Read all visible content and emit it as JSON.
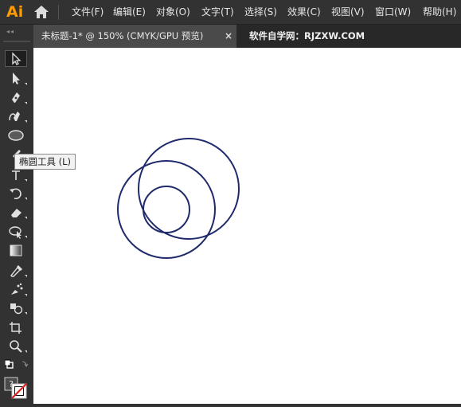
{
  "app": {
    "logo": "Ai"
  },
  "menu": {
    "items": [
      {
        "label": "文件(F)"
      },
      {
        "label": "编辑(E)"
      },
      {
        "label": "对象(O)"
      },
      {
        "label": "文字(T)"
      },
      {
        "label": "选择(S)"
      },
      {
        "label": "效果(C)"
      },
      {
        "label": "视图(V)"
      },
      {
        "label": "窗口(W)"
      },
      {
        "label": "帮助(H)"
      }
    ]
  },
  "document": {
    "tab_title": "未标题-1* @ 150% (CMYK/GPU 预览)",
    "close_symbol": "×",
    "watermark": "软件自学网：RJZXW.COM"
  },
  "tools": {
    "active": "ellipse-tool",
    "tooltip": "椭圆工具 (L)",
    "help_symbol": "?"
  },
  "colors": {
    "accent": "#FF9A00",
    "chrome": "#323232",
    "canvas": "#FFFFFF",
    "stroke": "#1F2A6B"
  }
}
